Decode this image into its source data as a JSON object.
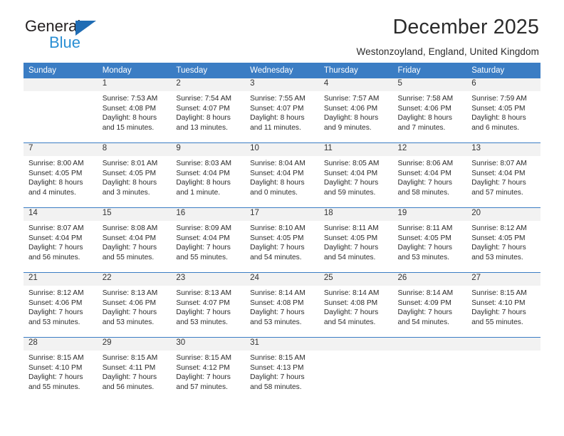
{
  "brand": {
    "name_dark": "General",
    "name_blue": "Blue",
    "triangle_color": "#1f6cb4",
    "blue_text_color": "#2a8fd4"
  },
  "header": {
    "title": "December 2025",
    "subtitle": "Westonzoyland, England, United Kingdom"
  },
  "theme": {
    "header_row_bg": "#3b7dc4",
    "daynum_bg": "#f2f2f2",
    "grid_line": "#3b7dc4"
  },
  "weekdays": [
    "Sunday",
    "Monday",
    "Tuesday",
    "Wednesday",
    "Thursday",
    "Friday",
    "Saturday"
  ],
  "weeks": [
    [
      {
        "day": "",
        "lines": []
      },
      {
        "day": "1",
        "lines": [
          "Sunrise: 7:53 AM",
          "Sunset: 4:08 PM",
          "Daylight: 8 hours",
          "and 15 minutes."
        ]
      },
      {
        "day": "2",
        "lines": [
          "Sunrise: 7:54 AM",
          "Sunset: 4:07 PM",
          "Daylight: 8 hours",
          "and 13 minutes."
        ]
      },
      {
        "day": "3",
        "lines": [
          "Sunrise: 7:55 AM",
          "Sunset: 4:07 PM",
          "Daylight: 8 hours",
          "and 11 minutes."
        ]
      },
      {
        "day": "4",
        "lines": [
          "Sunrise: 7:57 AM",
          "Sunset: 4:06 PM",
          "Daylight: 8 hours",
          "and 9 minutes."
        ]
      },
      {
        "day": "5",
        "lines": [
          "Sunrise: 7:58 AM",
          "Sunset: 4:06 PM",
          "Daylight: 8 hours",
          "and 7 minutes."
        ]
      },
      {
        "day": "6",
        "lines": [
          "Sunrise: 7:59 AM",
          "Sunset: 4:05 PM",
          "Daylight: 8 hours",
          "and 6 minutes."
        ]
      }
    ],
    [
      {
        "day": "7",
        "lines": [
          "Sunrise: 8:00 AM",
          "Sunset: 4:05 PM",
          "Daylight: 8 hours",
          "and 4 minutes."
        ]
      },
      {
        "day": "8",
        "lines": [
          "Sunrise: 8:01 AM",
          "Sunset: 4:05 PM",
          "Daylight: 8 hours",
          "and 3 minutes."
        ]
      },
      {
        "day": "9",
        "lines": [
          "Sunrise: 8:03 AM",
          "Sunset: 4:04 PM",
          "Daylight: 8 hours",
          "and 1 minute."
        ]
      },
      {
        "day": "10",
        "lines": [
          "Sunrise: 8:04 AM",
          "Sunset: 4:04 PM",
          "Daylight: 8 hours",
          "and 0 minutes."
        ]
      },
      {
        "day": "11",
        "lines": [
          "Sunrise: 8:05 AM",
          "Sunset: 4:04 PM",
          "Daylight: 7 hours",
          "and 59 minutes."
        ]
      },
      {
        "day": "12",
        "lines": [
          "Sunrise: 8:06 AM",
          "Sunset: 4:04 PM",
          "Daylight: 7 hours",
          "and 58 minutes."
        ]
      },
      {
        "day": "13",
        "lines": [
          "Sunrise: 8:07 AM",
          "Sunset: 4:04 PM",
          "Daylight: 7 hours",
          "and 57 minutes."
        ]
      }
    ],
    [
      {
        "day": "14",
        "lines": [
          "Sunrise: 8:07 AM",
          "Sunset: 4:04 PM",
          "Daylight: 7 hours",
          "and 56 minutes."
        ]
      },
      {
        "day": "15",
        "lines": [
          "Sunrise: 8:08 AM",
          "Sunset: 4:04 PM",
          "Daylight: 7 hours",
          "and 55 minutes."
        ]
      },
      {
        "day": "16",
        "lines": [
          "Sunrise: 8:09 AM",
          "Sunset: 4:04 PM",
          "Daylight: 7 hours",
          "and 55 minutes."
        ]
      },
      {
        "day": "17",
        "lines": [
          "Sunrise: 8:10 AM",
          "Sunset: 4:05 PM",
          "Daylight: 7 hours",
          "and 54 minutes."
        ]
      },
      {
        "day": "18",
        "lines": [
          "Sunrise: 8:11 AM",
          "Sunset: 4:05 PM",
          "Daylight: 7 hours",
          "and 54 minutes."
        ]
      },
      {
        "day": "19",
        "lines": [
          "Sunrise: 8:11 AM",
          "Sunset: 4:05 PM",
          "Daylight: 7 hours",
          "and 53 minutes."
        ]
      },
      {
        "day": "20",
        "lines": [
          "Sunrise: 8:12 AM",
          "Sunset: 4:05 PM",
          "Daylight: 7 hours",
          "and 53 minutes."
        ]
      }
    ],
    [
      {
        "day": "21",
        "lines": [
          "Sunrise: 8:12 AM",
          "Sunset: 4:06 PM",
          "Daylight: 7 hours",
          "and 53 minutes."
        ]
      },
      {
        "day": "22",
        "lines": [
          "Sunrise: 8:13 AM",
          "Sunset: 4:06 PM",
          "Daylight: 7 hours",
          "and 53 minutes."
        ]
      },
      {
        "day": "23",
        "lines": [
          "Sunrise: 8:13 AM",
          "Sunset: 4:07 PM",
          "Daylight: 7 hours",
          "and 53 minutes."
        ]
      },
      {
        "day": "24",
        "lines": [
          "Sunrise: 8:14 AM",
          "Sunset: 4:08 PM",
          "Daylight: 7 hours",
          "and 53 minutes."
        ]
      },
      {
        "day": "25",
        "lines": [
          "Sunrise: 8:14 AM",
          "Sunset: 4:08 PM",
          "Daylight: 7 hours",
          "and 54 minutes."
        ]
      },
      {
        "day": "26",
        "lines": [
          "Sunrise: 8:14 AM",
          "Sunset: 4:09 PM",
          "Daylight: 7 hours",
          "and 54 minutes."
        ]
      },
      {
        "day": "27",
        "lines": [
          "Sunrise: 8:15 AM",
          "Sunset: 4:10 PM",
          "Daylight: 7 hours",
          "and 55 minutes."
        ]
      }
    ],
    [
      {
        "day": "28",
        "lines": [
          "Sunrise: 8:15 AM",
          "Sunset: 4:10 PM",
          "Daylight: 7 hours",
          "and 55 minutes."
        ]
      },
      {
        "day": "29",
        "lines": [
          "Sunrise: 8:15 AM",
          "Sunset: 4:11 PM",
          "Daylight: 7 hours",
          "and 56 minutes."
        ]
      },
      {
        "day": "30",
        "lines": [
          "Sunrise: 8:15 AM",
          "Sunset: 4:12 PM",
          "Daylight: 7 hours",
          "and 57 minutes."
        ]
      },
      {
        "day": "31",
        "lines": [
          "Sunrise: 8:15 AM",
          "Sunset: 4:13 PM",
          "Daylight: 7 hours",
          "and 58 minutes."
        ]
      },
      {
        "day": "",
        "lines": []
      },
      {
        "day": "",
        "lines": []
      },
      {
        "day": "",
        "lines": []
      }
    ]
  ]
}
